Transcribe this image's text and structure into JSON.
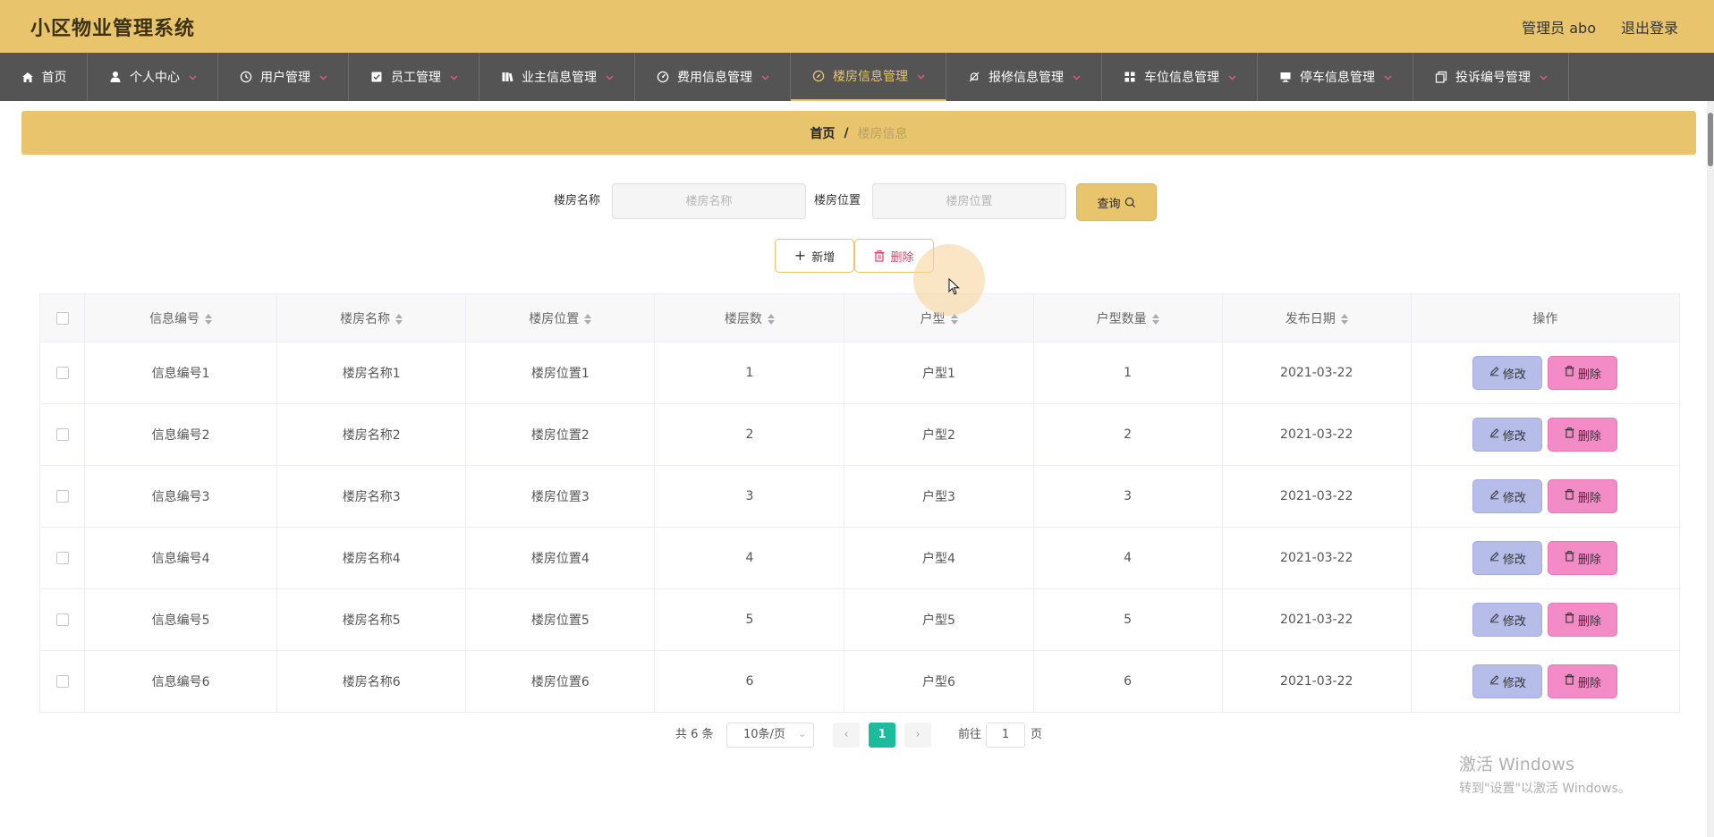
{
  "header": {
    "title": "小区物业管理系统",
    "user_label": "管理员 abo",
    "logout_label": "退出登录",
    "bg_color": "#e8c56d"
  },
  "nav": {
    "items": [
      {
        "label": "首页",
        "icon": "home-icon",
        "has_dropdown": false,
        "active": false
      },
      {
        "label": "个人中心",
        "icon": "user-icon",
        "has_dropdown": true,
        "active": false
      },
      {
        "label": "用户管理",
        "icon": "clock-icon",
        "has_dropdown": true,
        "active": false
      },
      {
        "label": "员工管理",
        "icon": "check-square-icon",
        "has_dropdown": true,
        "active": false
      },
      {
        "label": "业主信息管理",
        "icon": "books-icon",
        "has_dropdown": true,
        "active": false
      },
      {
        "label": "费用信息管理",
        "icon": "gauge-icon",
        "has_dropdown": true,
        "active": false
      },
      {
        "label": "楼房信息管理",
        "icon": "compass-icon",
        "has_dropdown": true,
        "active": true
      },
      {
        "label": "报修信息管理",
        "icon": "bell-off-icon",
        "has_dropdown": true,
        "active": false
      },
      {
        "label": "车位信息管理",
        "icon": "grid-icon",
        "has_dropdown": true,
        "active": false
      },
      {
        "label": "停车信息管理",
        "icon": "monitor-icon",
        "has_dropdown": true,
        "active": false
      },
      {
        "label": "投诉编号管理",
        "icon": "copy-icon",
        "has_dropdown": true,
        "active": false
      }
    ]
  },
  "breadcrumb": {
    "home": "首页",
    "separator": "/",
    "current": "楼房信息"
  },
  "search": {
    "name_label": "楼房名称",
    "name_placeholder": "楼房名称",
    "location_label": "楼房位置",
    "location_placeholder": "楼房位置",
    "query_label": "查询"
  },
  "actions": {
    "add_label": "新增",
    "delete_label": "删除"
  },
  "table": {
    "columns": [
      "信息编号",
      "楼房名称",
      "楼房位置",
      "楼层数",
      "户型",
      "户型数量",
      "发布日期",
      "操作"
    ],
    "edit_label": "修改",
    "delete_label": "删除",
    "rows": [
      [
        "信息编号1",
        "楼房名称1",
        "楼房位置1",
        "1",
        "户型1",
        "1",
        "2021-03-22"
      ],
      [
        "信息编号2",
        "楼房名称2",
        "楼房位置2",
        "2",
        "户型2",
        "2",
        "2021-03-22"
      ],
      [
        "信息编号3",
        "楼房名称3",
        "楼房位置3",
        "3",
        "户型3",
        "3",
        "2021-03-22"
      ],
      [
        "信息编号4",
        "楼房名称4",
        "楼房位置4",
        "4",
        "户型4",
        "4",
        "2021-03-22"
      ],
      [
        "信息编号5",
        "楼房名称5",
        "楼房位置5",
        "5",
        "户型5",
        "5",
        "2021-03-22"
      ],
      [
        "信息编号6",
        "楼房名称6",
        "楼房位置6",
        "6",
        "户型6",
        "6",
        "2021-03-22"
      ]
    ]
  },
  "pagination": {
    "total_text": "共 6 条",
    "page_size": "10条/页",
    "current_page": "1",
    "goto_label": "前往",
    "goto_value": "1",
    "page_unit": "页"
  },
  "watermark": {
    "line1": "激活 Windows",
    "line2": "转到\"设置\"以激活 Windows。"
  }
}
